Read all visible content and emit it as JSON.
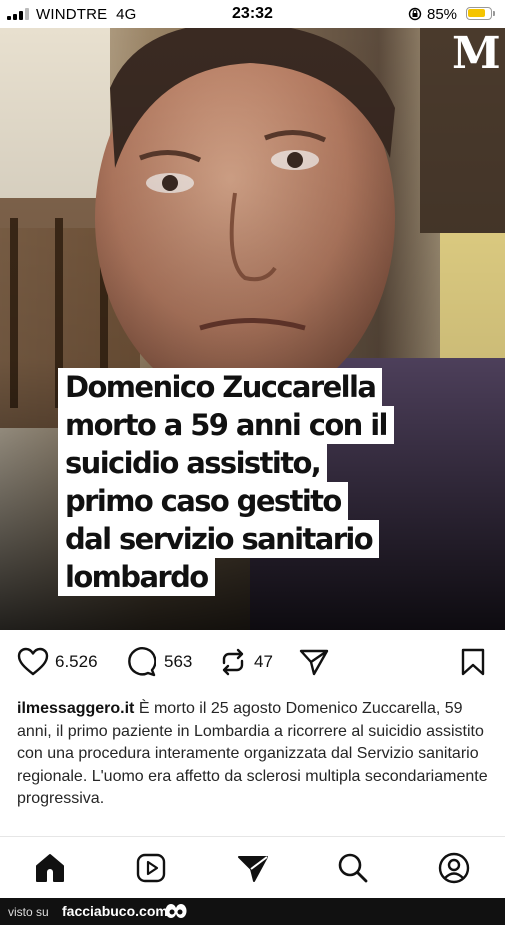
{
  "status_bar": {
    "carrier": "WINDTRE",
    "network": "4G",
    "time": "23:32",
    "battery_percent": "85%",
    "battery_level": 0.85,
    "battery_color": "#f5c400"
  },
  "post": {
    "publisher_logo": "M",
    "headline_lines": [
      "Domenico Zuccarella",
      "morto a 59 anni con il",
      "suicidio assistito,",
      "primo caso gestito",
      "dal servizio sanitario",
      "lombardo"
    ],
    "likes": "6.526",
    "comments": "563",
    "reposts": "47",
    "caption_user": "ilmessaggero.it",
    "caption_text": " È morto il 25 agosto Domenico Zuccarella, 59 anni, il primo paziente in Lombardia a ricorrere al suicidio assistito con una procedura interamente organizzata dal Servizio sanitario regionale. L'uomo era affetto da sclerosi multipla secondariamente progressiva."
  },
  "icons": {
    "like": "heart-icon",
    "comment": "comment-bubble-icon",
    "repost": "repost-icon",
    "share": "send-icon",
    "save": "bookmark-icon"
  },
  "tab_bar": [
    "home-icon",
    "reels-icon",
    "send-icon",
    "search-icon",
    "profile-icon"
  ],
  "watermark": {
    "prefix": "visto su",
    "site": "facciabuco.com"
  }
}
